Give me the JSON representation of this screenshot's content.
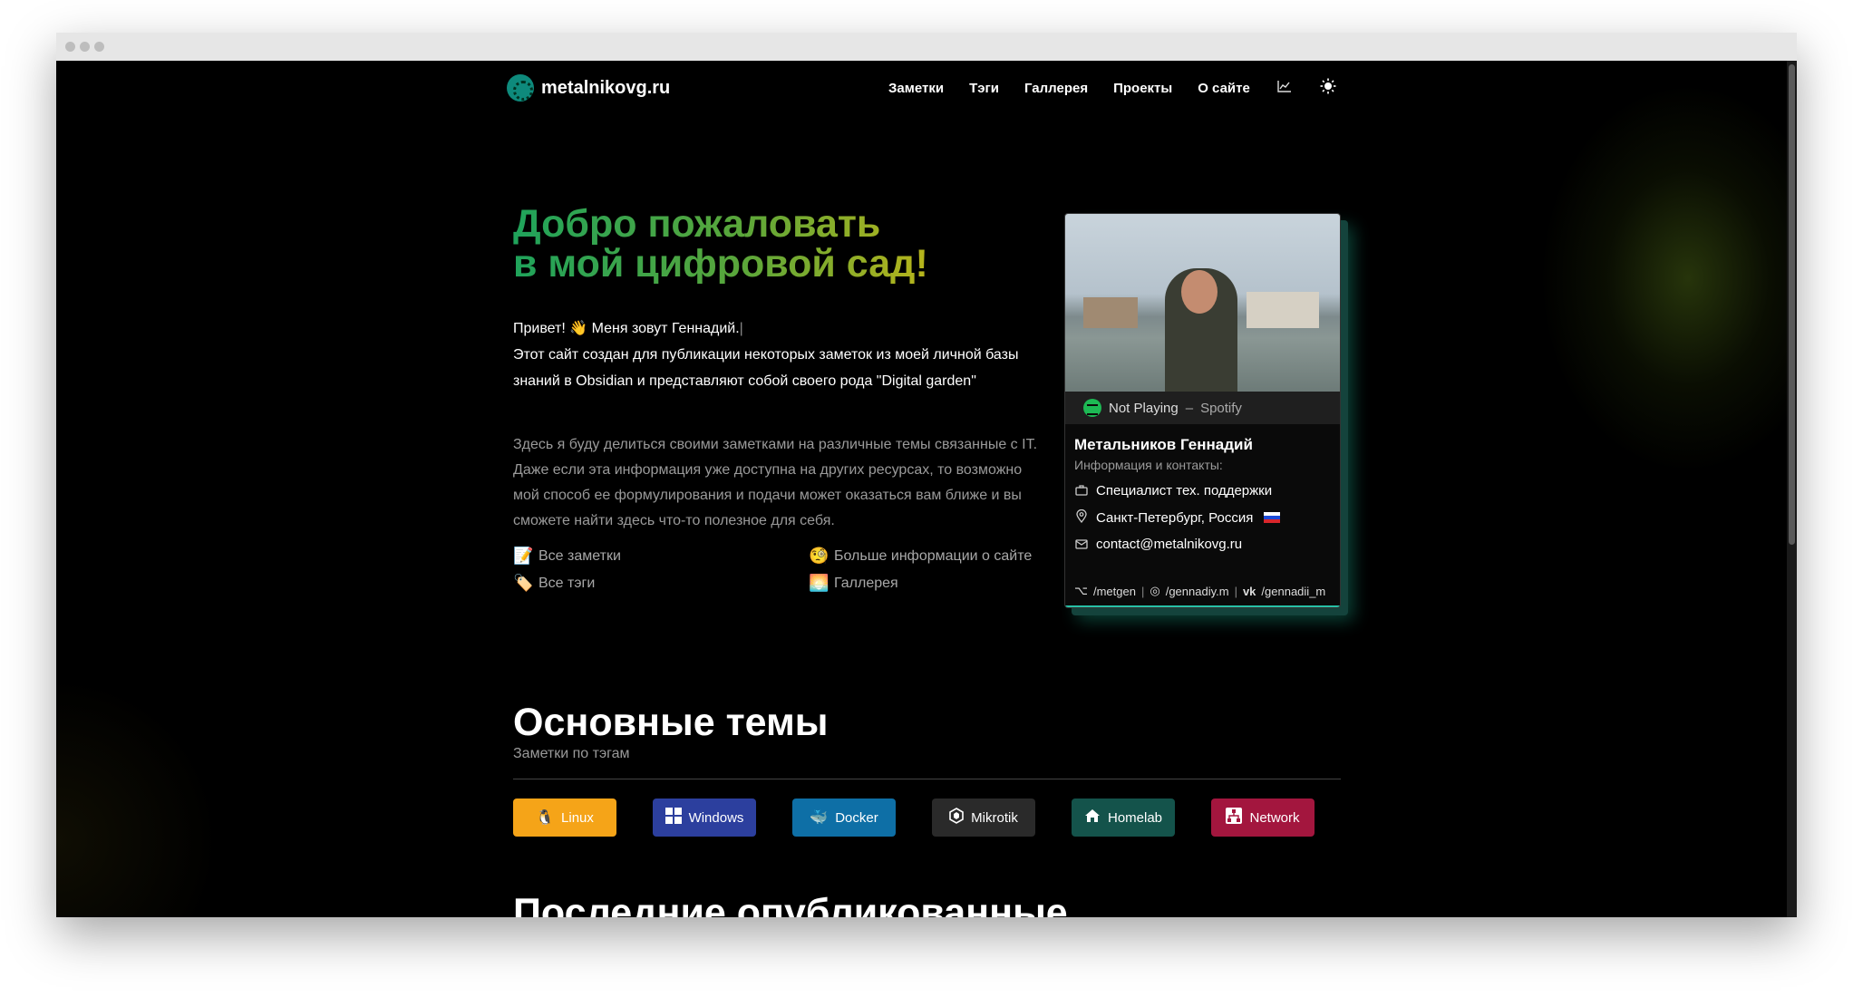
{
  "site": {
    "name": "metalnikovg.ru"
  },
  "nav": {
    "items": [
      "Заметки",
      "Тэги",
      "Галлерея",
      "Проекты",
      "О сайте"
    ],
    "stats_icon": "chart-icon",
    "theme_icon": "sun-icon"
  },
  "hero": {
    "title_line1": "Добро пожаловать",
    "title_line2": "в мой цифровой сад!",
    "greeting_before": "Привет!",
    "greeting_after": "Меня зовут Геннадий.",
    "cursor": "|",
    "intro": "Этот сайт создан для публикации некоторых заметок из моей личной базы знаний в Obsidian и представляют собой своего рода \"Digital garden\"",
    "description": "Здесь я буду делиться своими заметками на различные темы связанные с IT. Даже если эта информация уже доступна на других ресурсах, то возможно мой способ ее формулирования и подачи может оказаться вам ближе и вы сможете найти здесь что-то полезное для себя."
  },
  "quick_links": [
    {
      "label": "Все заметки",
      "emoji": "📝"
    },
    {
      "label": "Больше информации о сайте",
      "emoji": "🧐"
    },
    {
      "label": "Все тэги",
      "emoji": "🏷️"
    },
    {
      "label": "Галлерея",
      "emoji": "🌅"
    }
  ],
  "card": {
    "spotify_status": "Not Playing",
    "spotify_sep": "–",
    "spotify_source": "Spotify",
    "name": "Метальников Геннадий",
    "subtitle": "Информация и контакты:",
    "job": "Специалист тех. поддержки",
    "location": "Санкт-Петербург, Россия",
    "email": "contact@metalnikovg.ru",
    "socials": [
      {
        "icon": "github-icon",
        "handle": "/metgen"
      },
      {
        "icon": "instagram-icon",
        "handle": "/gennadiy.m"
      },
      {
        "icon": "vk-icon",
        "handle": "/gennadii_m"
      }
    ]
  },
  "topics": {
    "title": "Основные темы",
    "subtitle": "Заметки по тэгам",
    "tags": [
      {
        "label": "Linux",
        "color": "#f5a418"
      },
      {
        "label": "Windows",
        "color": "#2c3f9e"
      },
      {
        "label": "Docker",
        "color": "#0e6fa6"
      },
      {
        "label": "Mikrotik",
        "color": "#2a2a2a"
      },
      {
        "label": "Homelab",
        "color": "#14534b"
      },
      {
        "label": "Network",
        "color": "#a3163e"
      }
    ]
  },
  "latest": {
    "title": "Последние опубликованные"
  }
}
